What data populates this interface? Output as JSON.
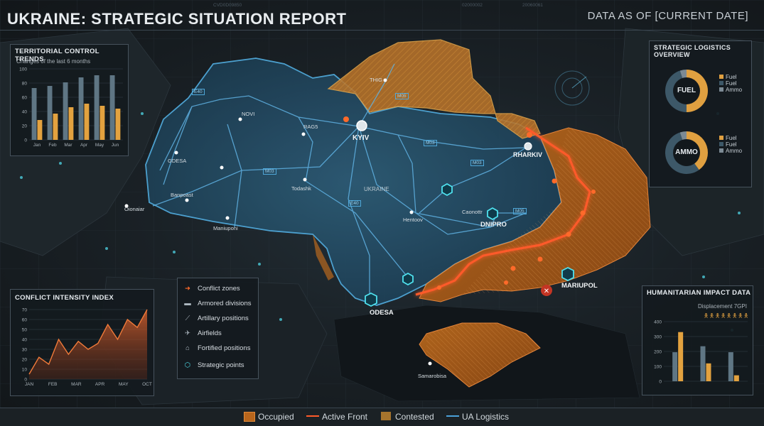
{
  "header": {
    "title": "UKRAINE: STRATEGIC SITUATION REPORT",
    "date_as_of": "DATA AS OF [CURRENT DATE]"
  },
  "territorial_panel": {
    "title": "TERRITORIAL CONTROL TRENDS",
    "subtitle": "Changes of the last 6 months"
  },
  "logistics_panel": {
    "title": "STRATEGIC LOGISTICS OVERVIEW",
    "donut1_label": "FUEL",
    "donut1_legend": [
      "Fuel",
      "Fuel",
      "Ammo"
    ],
    "donut2_label": "AMMO",
    "donut2_legend": [
      "Fuel",
      "Fuel",
      "Ammo"
    ],
    "colors": {
      "fuel": "#e0a040",
      "fuel2": "#3d5868",
      "ammo": "#7c8a94"
    }
  },
  "intensity_panel": {
    "title": "CONFLICT INTENSITY INDEX"
  },
  "humanitarian_panel": {
    "title": "HUMANITARIAN IMPACT DATA",
    "subtitle": "Displacement 7GPI"
  },
  "map_legend": {
    "items": [
      {
        "label": "Conflict zones",
        "icon": "arrow-icon"
      },
      {
        "label": "Armored divisions",
        "icon": "tank-icon"
      },
      {
        "label": "Artillary positions",
        "icon": "artillery-icon"
      },
      {
        "label": "Airfields",
        "icon": "plane-icon"
      },
      {
        "label": "Fortified positions",
        "icon": "fort-icon"
      },
      {
        "label": "Strategic points",
        "icon": "hexagon-icon"
      }
    ]
  },
  "map": {
    "country_label": "UKRAINE",
    "cities": {
      "kyiv": "KYIV",
      "kharkiv": "RHARKIV",
      "dnipro": "DNIPRO",
      "odesa": "ODESA",
      "mariupol": "MARIUPOL",
      "thig": "THIG",
      "novi": "NOVI",
      "rag5": "RAG5",
      "gdesa": "GDESA",
      "banpoast": "Banpoast",
      "oionaiar": "Oionaiar",
      "maniuponi": "Maniuponi",
      "lodashk": "Todashk",
      "hentoov": "Hentoov",
      "caonottr": "Caonottr",
      "samarobisa": "Samarobisa"
    },
    "roads": {
      "e40_west": "E40",
      "e40_center": "E40",
      "m05_north": "M05",
      "m03_center": "M03",
      "m03_east": "M03",
      "m03_west": "M03",
      "m05_east": "M05"
    }
  },
  "bottom_legend": {
    "occupied": "Occupied",
    "active_front": "Active Front",
    "contested": "Contested",
    "ua_logistics": "UA Logistics",
    "colors": {
      "occupied": "#b8651c",
      "front": "#ff5a2a",
      "contested": "#c98a30",
      "logistics": "#4aa0d8"
    }
  },
  "chart_data": [
    {
      "type": "bar",
      "title": "TERRITORIAL CONTROL TRENDS",
      "subtitle": "Changes of the last 6 months",
      "categories": [
        "Jan",
        "Feb",
        "Mar",
        "Apr",
        "May",
        "Jun"
      ],
      "ylim": [
        0,
        100
      ],
      "yticks": [
        0,
        20,
        40,
        60,
        80,
        100
      ],
      "series": [
        {
          "values": [
            73,
            76,
            81,
            88,
            91,
            91
          ],
          "color": "#5f7684"
        },
        {
          "values": [
            28,
            37,
            46,
            51,
            48,
            44
          ],
          "color": "#e3a23f"
        }
      ],
      "grid": true
    },
    {
      "type": "pie",
      "title": "FUEL",
      "slices": [
        {
          "label": "Fuel",
          "value": 50
        },
        {
          "label": "Fuel",
          "value": 45
        },
        {
          "label": "Ammo",
          "value": 5
        }
      ]
    },
    {
      "type": "pie",
      "title": "AMMO",
      "slices": [
        {
          "label": "Fuel",
          "value": 40
        },
        {
          "label": "Fuel",
          "value": 55
        },
        {
          "label": "Ammo",
          "value": 5
        }
      ]
    },
    {
      "type": "area",
      "title": "CONFLICT INTENSITY INDEX",
      "categories": [
        "JAN",
        "FEB",
        "MAR",
        "APR",
        "MAY",
        "OCT"
      ],
      "values": [
        5,
        22,
        15,
        40,
        25,
        38,
        30,
        36,
        55,
        40,
        60,
        52,
        70
      ],
      "ylim": [
        0,
        70
      ],
      "yticks": [
        0,
        10,
        20,
        30,
        40,
        50,
        60,
        70
      ],
      "grid": true
    },
    {
      "type": "bar",
      "title": "HUMANITARIAN IMPACT DATA",
      "subtitle": "Displacement 7GPI",
      "categories": [
        "",
        "",
        ""
      ],
      "ylim": [
        0,
        400
      ],
      "yticks": [
        0,
        100,
        200,
        300,
        400
      ],
      "series": [
        {
          "values": [
            195,
            235,
            195
          ],
          "color": "#5f7684"
        },
        {
          "values": [
            330,
            120,
            40
          ],
          "color": "#e3a23f"
        }
      ],
      "grid": true
    }
  ]
}
